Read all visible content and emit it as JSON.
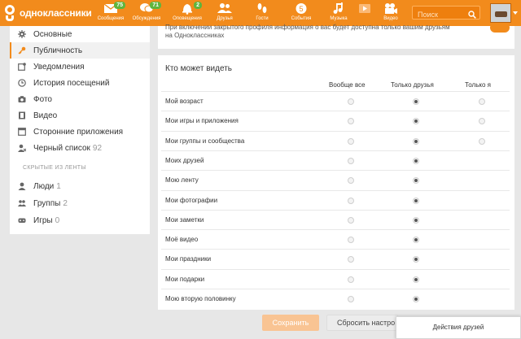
{
  "brand": {
    "name": "одноклассники"
  },
  "nav": [
    {
      "icon": "envelope-icon",
      "label": "Сообщения",
      "badge": "75"
    },
    {
      "icon": "chat-bubbles-icon",
      "label": "Обсуждения",
      "badge": "71"
    },
    {
      "icon": "bell-icon",
      "label": "Оповещения",
      "badge": "2"
    },
    {
      "icon": "friends-icon",
      "label": "Друзья",
      "badge": ""
    },
    {
      "icon": "footprints-icon",
      "label": "Гости",
      "badge": ""
    },
    {
      "icon": "events-icon",
      "label": "События",
      "badge": ""
    },
    {
      "icon": "music-note-icon",
      "label": "Музыка",
      "badge": ""
    },
    {
      "icon": "video-camera-icon",
      "label": "Видео",
      "badge": ""
    }
  ],
  "search": {
    "placeholder": "Поиск"
  },
  "sidebar": {
    "items": [
      {
        "icon": "gear-icon",
        "label": "Основные",
        "count": ""
      },
      {
        "icon": "key-icon",
        "label": "Публичность",
        "count": ""
      },
      {
        "icon": "notifications-icon",
        "label": "Уведомления",
        "count": ""
      },
      {
        "icon": "clock-icon",
        "label": "История посещений",
        "count": ""
      },
      {
        "icon": "camera-icon",
        "label": "Фото",
        "count": ""
      },
      {
        "icon": "film-icon",
        "label": "Видео",
        "count": ""
      },
      {
        "icon": "apps-icon",
        "label": "Сторонние приложения",
        "count": ""
      },
      {
        "icon": "blocked-user-icon",
        "label": "Черный список",
        "count": "92"
      }
    ],
    "section_title": "СКРЫТЫЕ ИЗ ЛЕНТЫ",
    "hidden": [
      {
        "icon": "person-icon",
        "label": "Люди",
        "count": "1"
      },
      {
        "icon": "group-icon",
        "label": "Группы",
        "count": "2"
      },
      {
        "icon": "gamepad-icon",
        "label": "Игры",
        "count": "0"
      }
    ]
  },
  "notice": {
    "text": "При включении закрытого профиля информация о вас будет доступна только вашим друзьям на Одноклассниках"
  },
  "privacy": {
    "title": "Кто может видеть",
    "columns": [
      "Вообще все",
      "Только друзья",
      "Только я"
    ],
    "rows": [
      {
        "label": "Мой возраст",
        "selected": 1,
        "options": 3
      },
      {
        "label": "Мои игры и приложения",
        "selected": 1,
        "options": 3
      },
      {
        "label": "Мои группы и сообщества",
        "selected": 1,
        "options": 3
      },
      {
        "label": "Моих друзей",
        "selected": 1,
        "options": 2
      },
      {
        "label": "Мою ленту",
        "selected": 1,
        "options": 2
      },
      {
        "label": "Мои фотографии",
        "selected": 1,
        "options": 2
      },
      {
        "label": "Мои заметки",
        "selected": 1,
        "options": 2
      },
      {
        "label": "Моё видео",
        "selected": 1,
        "options": 2
      },
      {
        "label": "Мои праздники",
        "selected": 1,
        "options": 2
      },
      {
        "label": "Мои подарки",
        "selected": 1,
        "options": 2
      },
      {
        "label": "Мою вторую половинку",
        "selected": 1,
        "options": 2
      }
    ]
  },
  "buttons": {
    "save": "Сохранить",
    "reset": "Сбросить настро"
  },
  "popup": {
    "label": "Действия друзей"
  },
  "colors": {
    "brand_orange": "#f28b1c",
    "badge_green": "#5fb53d"
  }
}
